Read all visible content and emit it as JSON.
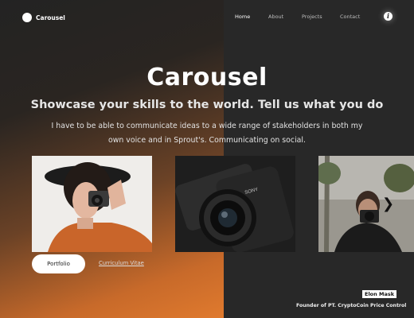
{
  "brand": {
    "name": "Carousel",
    "logo_icon": "circle-logo-icon"
  },
  "nav": {
    "items": [
      {
        "label": "Home",
        "active": true
      },
      {
        "label": "About",
        "active": false
      },
      {
        "label": "Projects",
        "active": false
      },
      {
        "label": "Contact",
        "active": false
      }
    ],
    "info_icon": "info-icon"
  },
  "hero": {
    "title": "Carousel",
    "subtitle": "Showcase your skills to the world. Tell us what you do",
    "description": "I have to be able to communicate ideas to a wide range of stakeholders in both my own voice and in Sprout's. Communicating on social."
  },
  "carousel": {
    "slides": [
      {
        "image": "woman-with-camera-photo"
      },
      {
        "image": "camera-closeup-photo"
      },
      {
        "image": "man-with-camera-photo"
      }
    ],
    "next_icon": "chevron-right-icon"
  },
  "actions": {
    "primary_label": "Portfolio",
    "secondary_label": "Curriculum Vitae"
  },
  "profile": {
    "name": "Elon Mask",
    "role": "Founder of PT. CryptoCoin Price Control"
  },
  "colors": {
    "accent_orange": "#e07a2e",
    "dark_bg": "#282828",
    "button_bg": "#ffffff"
  }
}
